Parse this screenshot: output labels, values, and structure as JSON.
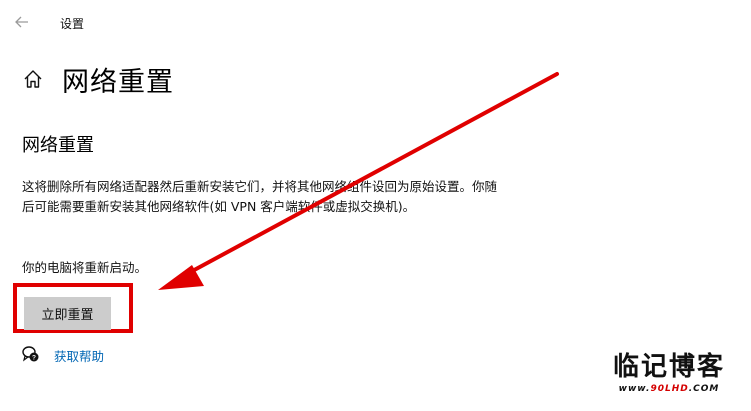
{
  "window": {
    "title": "设置"
  },
  "page": {
    "title": "网络重置"
  },
  "section": {
    "title": "网络重置",
    "description": "这将删除所有网络适配器然后重新安装它们，并将其他网络组件设回为原始设置。你随后可能需要重新安装其他网络软件(如 VPN 客户端软件或虚拟交换机)。",
    "restart_note": "你的电脑将重新启动。",
    "reset_button": "立即重置"
  },
  "help": {
    "label": "获取帮助"
  },
  "watermark": {
    "title": "临记博客",
    "url_prefix": "www.",
    "url_host": "90LHD",
    "url_suffix": ".COM"
  },
  "colors": {
    "highlight": "#e00000",
    "link": "#0066b4",
    "button_bg": "#cccccc"
  },
  "icons": {
    "back": "arrow-left-icon",
    "home": "home-icon",
    "help": "help-chat-icon"
  }
}
